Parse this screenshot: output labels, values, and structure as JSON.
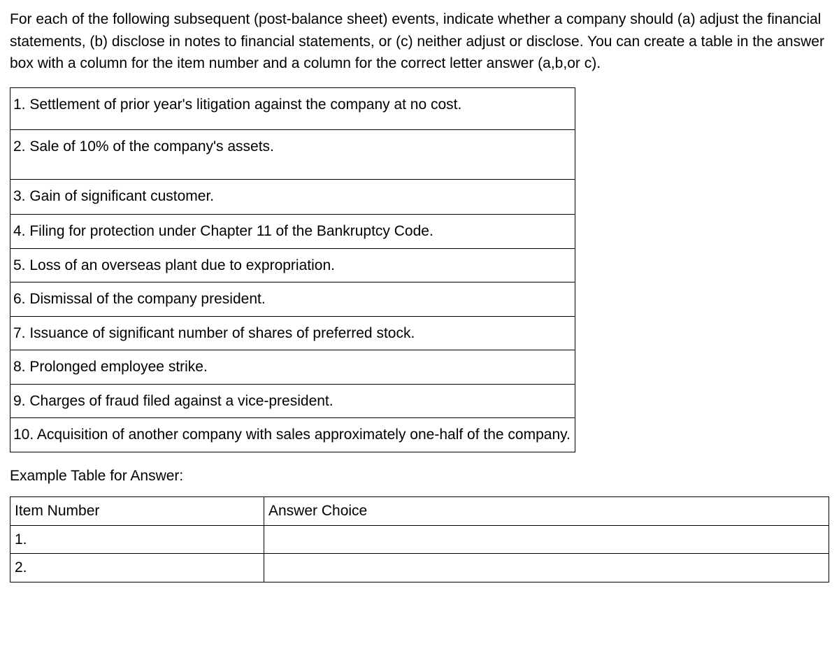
{
  "intro": "For each of the following subsequent (post-balance sheet) events, indicate whether a company should (a) adjust the financial statements, (b) disclose in notes to financial statements, or (c) neither adjust or disclose. You can create a table in the answer box with a column for the item number and a column for the correct letter answer (a,b,or c).",
  "items": [
    "1. Settlement of prior year's litigation against the company at no cost.",
    "2. Sale of 10% of the company's assets.",
    "3. Gain of significant customer.",
    "4. Filing for protection under Chapter 11 of the Bankruptcy Code.",
    "5. Loss of an overseas plant due to expropriation.",
    "6. Dismissal of the company president.",
    "7. Issuance of significant number of shares of preferred stock.",
    "8. Prolonged employee strike.",
    "9. Charges of fraud filed against a vice-president.",
    "10. Acquisition of another company with sales approximately one-half of the company."
  ],
  "example_label": "Example Table for Answer:",
  "answer_table": {
    "header_col1": "Item Number",
    "header_col2": "Answer Choice",
    "rows": [
      {
        "col1": "1.",
        "col2": ""
      },
      {
        "col1": "2.",
        "col2": ""
      }
    ]
  }
}
